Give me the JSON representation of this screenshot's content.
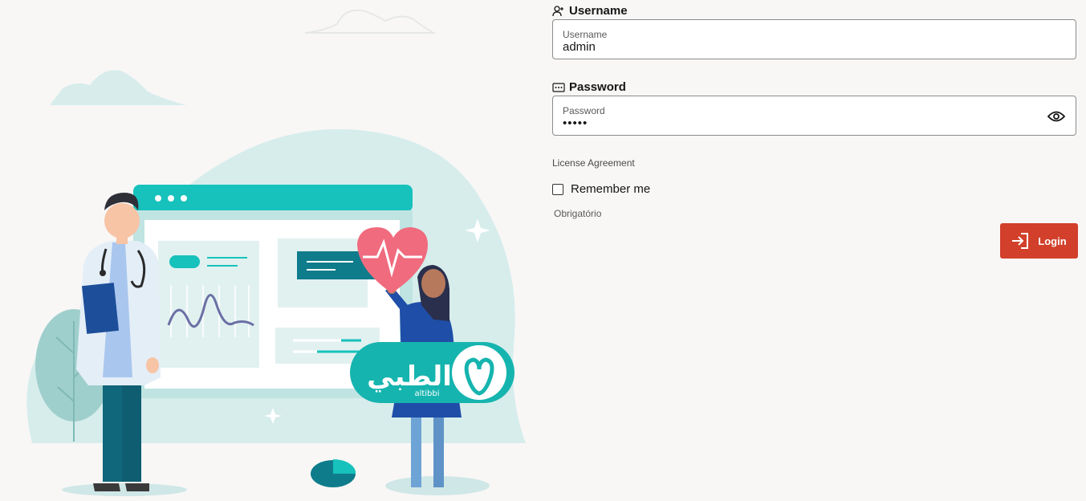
{
  "illustration": {
    "brand_arabic": "الطبي",
    "brand_latin": "altibbi"
  },
  "username": {
    "heading": "Username",
    "label": "Username",
    "value": "admin",
    "icon": "user-plus-icon"
  },
  "password": {
    "heading": "Password",
    "label": "Password",
    "value": "•••••",
    "icon": "password-dots-icon",
    "toggle_icon": "eye-icon"
  },
  "license_link": "License Agreement",
  "remember_me": {
    "label": "Remember me",
    "checked": false
  },
  "required_note": "Obrigatório",
  "login_button": {
    "label": "Login",
    "icon": "sign-in-icon",
    "color": "#d23f2b"
  },
  "colors": {
    "background": "#f8f7f6",
    "teal": "#16c2bb",
    "dark_teal": "#0f7c8c",
    "heart": "#f06b7e"
  }
}
